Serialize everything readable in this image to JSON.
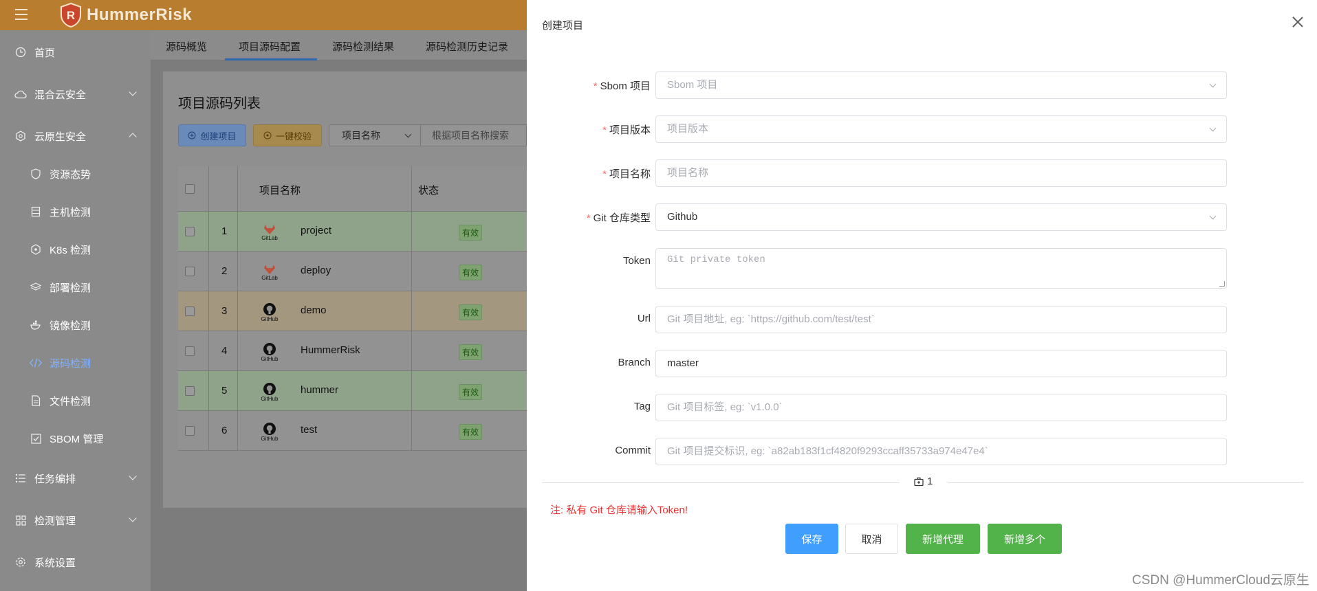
{
  "app": {
    "name": "HummerRisk"
  },
  "sidebar": {
    "items": [
      {
        "label": "首页",
        "icon": "clock-icon",
        "expandable": false
      },
      {
        "label": "混合云安全",
        "icon": "cloud-icon",
        "expandable": true,
        "expanded": false
      },
      {
        "label": "云原生安全",
        "icon": "cloud-native-icon",
        "expandable": true,
        "expanded": true
      },
      {
        "label": "资源态势",
        "icon": "shield-icon",
        "sub": true
      },
      {
        "label": "主机检测",
        "icon": "server-icon",
        "sub": true
      },
      {
        "label": "K8s 检测",
        "icon": "k8s-icon",
        "sub": true
      },
      {
        "label": "部署检测",
        "icon": "layers-icon",
        "sub": true
      },
      {
        "label": "镜像检测",
        "icon": "docker-icon",
        "sub": true
      },
      {
        "label": "源码检测",
        "icon": "code-icon",
        "sub": true,
        "active": true
      },
      {
        "label": "文件检测",
        "icon": "file-icon",
        "sub": true
      },
      {
        "label": "SBOM 管理",
        "icon": "check-square-icon",
        "sub": true
      },
      {
        "label": "任务编排",
        "icon": "list-icon",
        "expandable": true,
        "expanded": false
      },
      {
        "label": "检测管理",
        "icon": "grid-icon",
        "expandable": true,
        "expanded": false
      },
      {
        "label": "系统设置",
        "icon": "gear-icon",
        "expandable": false
      }
    ]
  },
  "tabs": [
    {
      "label": "源码概览"
    },
    {
      "label": "项目源码配置",
      "active": true
    },
    {
      "label": "源码检测结果"
    },
    {
      "label": "源码检测历史记录"
    }
  ],
  "list": {
    "title": "项目源码列表",
    "create_label": "创建项目",
    "verify_label": "一键校验",
    "filter_select": "项目名称",
    "search_placeholder": "根据项目名称搜索",
    "columns": {
      "name": "项目名称",
      "status": "状态"
    },
    "rows": [
      {
        "index": "1",
        "name": "project",
        "source": "GitLab",
        "status": "有效"
      },
      {
        "index": "2",
        "name": "deploy",
        "source": "GitLab",
        "status": "有效"
      },
      {
        "index": "3",
        "name": "demo",
        "source": "GitHub",
        "status": "有效"
      },
      {
        "index": "4",
        "name": "HummerRisk",
        "source": "GitHub",
        "status": "有效"
      },
      {
        "index": "5",
        "name": "hummer",
        "source": "GitHub",
        "status": "有效"
      },
      {
        "index": "6",
        "name": "test",
        "source": "GitHub",
        "status": "有效"
      }
    ]
  },
  "drawer": {
    "title": "创建项目",
    "fields": {
      "sbom": {
        "label": "Sbom 项目",
        "placeholder": "Sbom 项目",
        "required": true
      },
      "version": {
        "label": "项目版本",
        "placeholder": "项目版本",
        "required": true
      },
      "name": {
        "label": "项目名称",
        "placeholder": "项目名称",
        "required": true
      },
      "repo_type": {
        "label": "Git 仓库类型",
        "value": "Github",
        "required": true
      },
      "token": {
        "label": "Token",
        "placeholder": "Git private token"
      },
      "url": {
        "label": "Url",
        "placeholder": "Git 项目地址, eg: `https://github.com/test/test`"
      },
      "branch": {
        "label": "Branch",
        "value": "master"
      },
      "tag": {
        "label": "Tag",
        "placeholder": "Git 项目标签, eg: `v1.0.0`"
      },
      "commit": {
        "label": "Commit",
        "placeholder": "Git 项目提交标识, eg: `a82ab183f1cf4820f9293ccaff35733a974e47e4`"
      }
    },
    "proxy_count": "1",
    "note": "注: 私有 Git 仓库请输入Token!",
    "buttons": {
      "save": "保存",
      "cancel": "取消",
      "add_proxy": "新增代理",
      "add_multiple": "新增多个"
    }
  },
  "watermark": "CSDN @HummerCloud云原生",
  "colors": {
    "topbar": "#b87d2e",
    "primary": "#409eff",
    "success": "#52b34a",
    "danger": "#f02d2d",
    "active_menu": "#7fb1ff"
  }
}
